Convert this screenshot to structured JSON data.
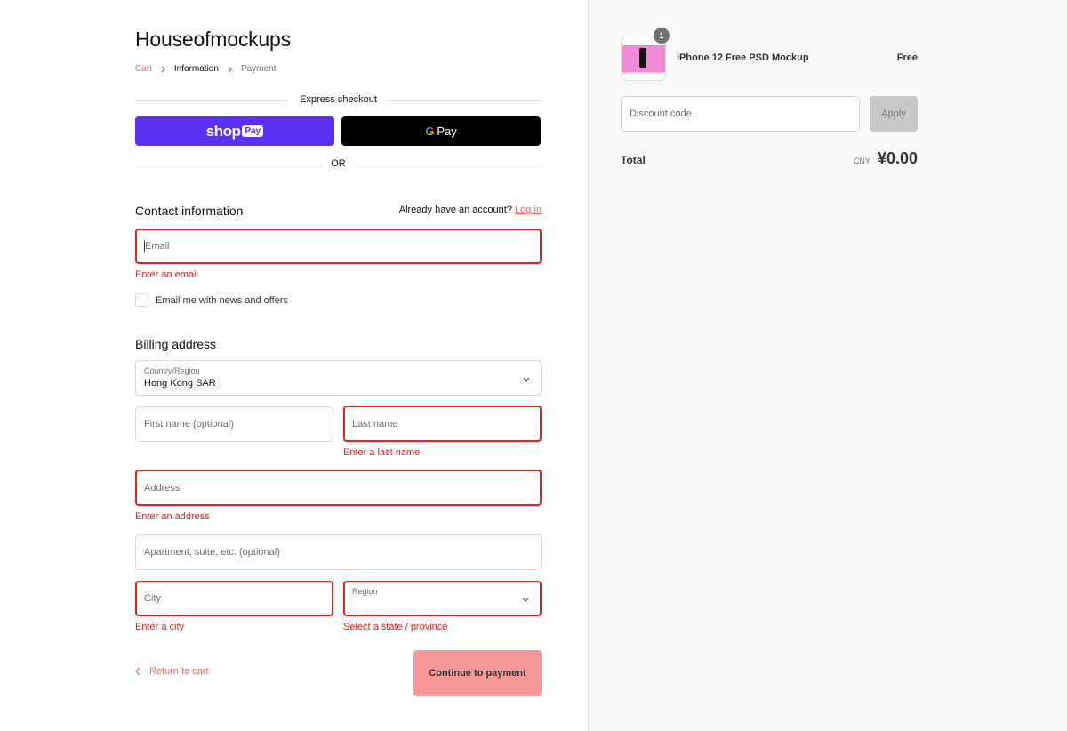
{
  "store": {
    "name": "Houseofmockups"
  },
  "breadcrumb": {
    "cart": "Cart",
    "information": "Information",
    "payment": "Payment"
  },
  "express": {
    "label": "Express checkout",
    "shop_logo": "shop",
    "shop_chip": "Pay",
    "gpay_g": "G",
    "gpay_label": "Pay",
    "or": "OR"
  },
  "contact": {
    "title": "Contact information",
    "account_prompt": "Already have an account?",
    "login": "Log in",
    "email_placeholder": "Email",
    "email_error": "Enter an email",
    "newsletter": "Email me with news and offers"
  },
  "billing": {
    "title": "Billing address",
    "country_label": "Country/Region",
    "country_value": "Hong Kong SAR",
    "first_name_placeholder": "First name (optional)",
    "last_name_placeholder": "Last name",
    "last_name_error": "Enter a last name",
    "address_placeholder": "Address",
    "address_error": "Enter an address",
    "apartment_placeholder": "Apartment, suite, etc. (optional)",
    "city_placeholder": "City",
    "city_error": "Enter a city",
    "region_label": "Region",
    "region_error": "Select a state / province"
  },
  "footer": {
    "return": "Return to cart",
    "continue": "Continue to payment"
  },
  "summary": {
    "quantity": "1",
    "product_name": "iPhone 12 Free PSD Mockup",
    "product_price": "Free",
    "discount_placeholder": "Discount code",
    "apply": "Apply",
    "total_label": "Total",
    "currency": "CNY",
    "total_amount": "¥0.00"
  },
  "colors": {
    "accent": "#f06a6a",
    "error": "#e22120",
    "shop_pay": "#5a31f4",
    "continue_bg": "#f79797"
  }
}
